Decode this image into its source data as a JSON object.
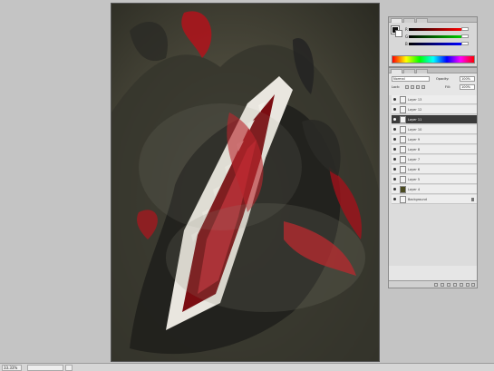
{
  "color_panel": {
    "tabs": [
      "Color",
      "Swatches",
      "Styles"
    ],
    "sliders": [
      {
        "channel": "R",
        "value": "",
        "color": "#d44"
      },
      {
        "channel": "G",
        "value": "",
        "color": "#4a4"
      },
      {
        "channel": "B",
        "value": "",
        "color": "#44d"
      }
    ]
  },
  "layers_panel": {
    "tabs": [
      "Layers",
      "Channels",
      "Paths"
    ],
    "blend_mode": "Normal",
    "opacity_label": "Opacity:",
    "opacity": "100%",
    "fill_label": "Fill:",
    "fill": "100%",
    "lock_label": "Lock:",
    "layers": [
      {
        "name": "Layer 13",
        "selected": false
      },
      {
        "name": "Layer 12",
        "selected": false
      },
      {
        "name": "Layer 11",
        "selected": true
      },
      {
        "name": "Layer 10",
        "selected": false
      },
      {
        "name": "Layer 9",
        "selected": false
      },
      {
        "name": "Layer 8",
        "selected": false
      },
      {
        "name": "Layer 7",
        "selected": false
      },
      {
        "name": "Layer 6",
        "selected": false
      },
      {
        "name": "Layer 5",
        "selected": false
      },
      {
        "name": "Layer 4",
        "selected": false
      },
      {
        "name": "Background",
        "selected": false
      }
    ]
  },
  "status_bar": {
    "zoom": "33.33%",
    "doc_info": ""
  }
}
